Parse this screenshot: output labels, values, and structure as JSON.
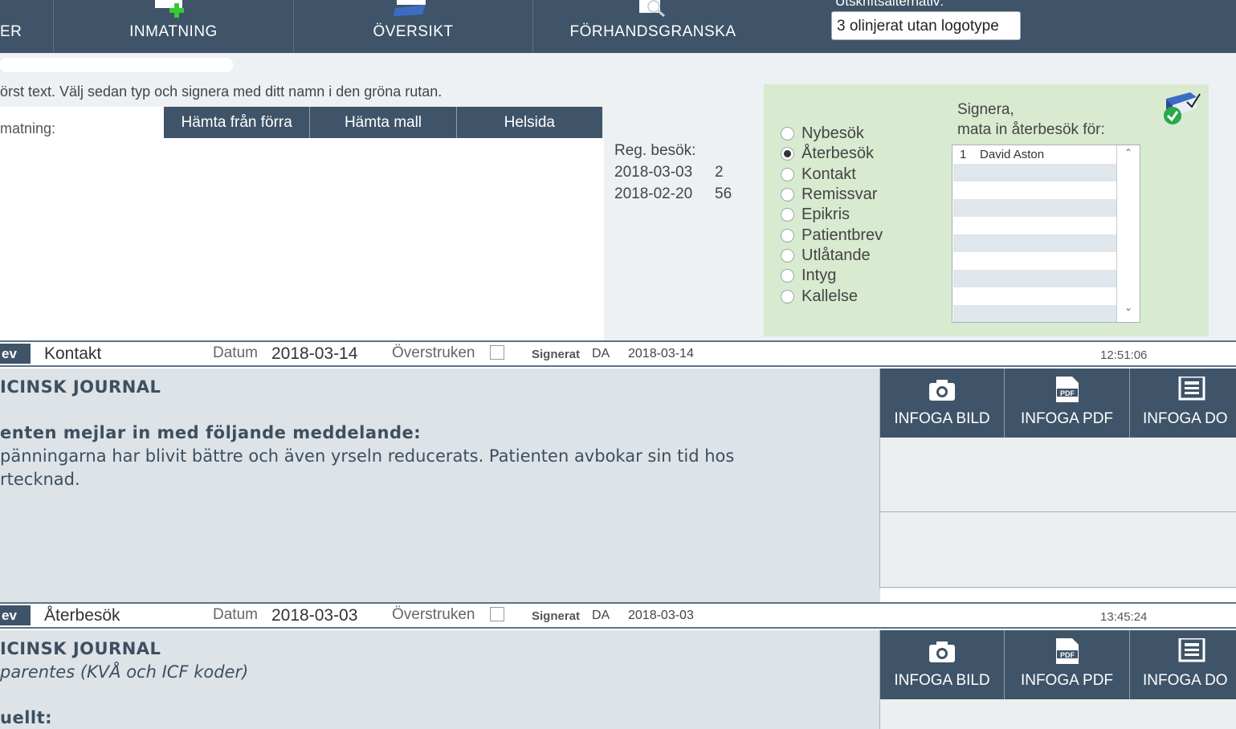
{
  "nav": {
    "left_partial": "ER",
    "inmatning": "INMATNING",
    "oversikt": "ÖVERSIKT",
    "forhandsgranska": "FÖRHANDSGRANSKA",
    "print_label": "Utskriftsalternativ:",
    "print_value": "3 olinjerat utan logotype"
  },
  "entry": {
    "instruction": "örst text. Välj sedan typ och signera med ditt namn i den gröna rutan.",
    "inmatning_label": "matning:",
    "toolbar": [
      "Hämta från förra",
      "Hämta mall",
      "Helsida"
    ],
    "reg_title": "Reg. besök:",
    "reg_visits": [
      {
        "date": "2018-03-03",
        "count": "2"
      },
      {
        "date": "2018-02-20",
        "count": "56"
      }
    ]
  },
  "sign": {
    "title_line1": "Signera,",
    "title_line2": "mata in återbesök för:",
    "types": [
      "Nybesök",
      "Återbesök",
      "Kontakt",
      "Remissvar",
      "Epikris",
      "Patientbrev",
      "Utlåtande",
      "Intyg",
      "Kallelse"
    ],
    "selected_type": "Återbesök",
    "list_first_num": "1",
    "list_first_name": "David Aston",
    "colors": {
      "panel": "#d8ead0",
      "check": "#2aa84a"
    }
  },
  "entries": [
    {
      "tag": "ev",
      "type": "Kontakt",
      "datum_label": "Datum",
      "datum": "2018-03-14",
      "overstruken_label": "Överstruken",
      "signerat_label": "Signerat",
      "signer": "DA",
      "sign_date": "2018-03-14",
      "time": "12:51:06",
      "lines": [
        "ICINSK JOURNAL",
        "enten mejlar in med följande meddelande:",
        "pänningarna har blivit bättre och även yrseln reducerats. Patienten avbokar sin tid hos",
        "rtecknad."
      ],
      "buttons": [
        "INFOGA BILD",
        "INFOGA PDF",
        "INFOGA DO"
      ]
    },
    {
      "tag": "ev",
      "type": "Återbesök",
      "datum_label": "Datum",
      "datum": "2018-03-03",
      "overstruken_label": "Överstruken",
      "signerat_label": "Signerat",
      "signer": "DA",
      "sign_date": "2018-03-03",
      "time": "13:45:24",
      "lines": [
        "ICINSK JOURNAL",
        " parentes (KVÅ och ICF koder)",
        "uellt:"
      ],
      "buttons": [
        "INFOGA BILD",
        "INFOGA PDF",
        "INFOGA DO"
      ]
    }
  ]
}
